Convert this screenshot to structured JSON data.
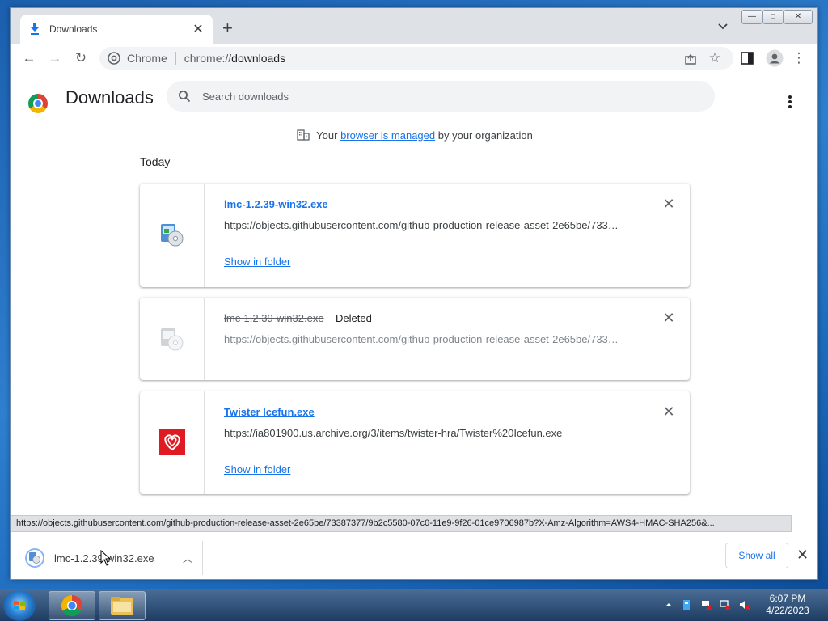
{
  "tab": {
    "title": "Downloads"
  },
  "window_controls": {
    "minimize": "—",
    "maximize": "□",
    "close": "✕"
  },
  "omnibox": {
    "chrome_label": "Chrome",
    "url_scheme": "chrome://",
    "url_host": "downloads"
  },
  "page": {
    "title": "Downloads",
    "search_placeholder": "Search downloads",
    "managed": {
      "prefix": "Your",
      "link": "browser is managed",
      "suffix": "by your organization"
    },
    "section_label": "Today"
  },
  "downloads": [
    {
      "name": "lmc-1.2.39-win32.exe",
      "status": "",
      "url": "https://objects.githubusercontent.com/github-production-release-asset-2e65be/733…",
      "action": "Show in folder",
      "remove": "✕"
    },
    {
      "name": "lmc-1.2.39-win32.exe",
      "status": "Deleted",
      "url": "https://objects.githubusercontent.com/github-production-release-asset-2e65be/733…",
      "remove": "✕"
    },
    {
      "name": "Twister Icefun.exe",
      "status": "",
      "url": "https://ia801900.us.archive.org/3/items/twister-hra/Twister%20Icefun.exe",
      "action": "Show in folder",
      "remove": "✕"
    }
  ],
  "status_url": "https://objects.githubusercontent.com/github-production-release-asset-2e65be/73387377/9b2c5580-07c0-11e9-9f26-01ce9706987b?X-Amz-Algorithm=AWS4-HMAC-SHA256&...",
  "shelf": {
    "item_name": "lmc-1.2.39-win32.exe",
    "show_all": "Show all",
    "close": "✕"
  },
  "taskbar": {
    "time": "6:07 PM",
    "date": "4/22/2023",
    "pinned": [
      "chrome-icon",
      "file-explorer-icon"
    ]
  },
  "colors": {
    "link": "#1a73e8",
    "text": "#202124",
    "secondary_text": "#5f6368",
    "toolbar_bg": "#dee1e6",
    "search_bg": "#f1f3f4"
  }
}
